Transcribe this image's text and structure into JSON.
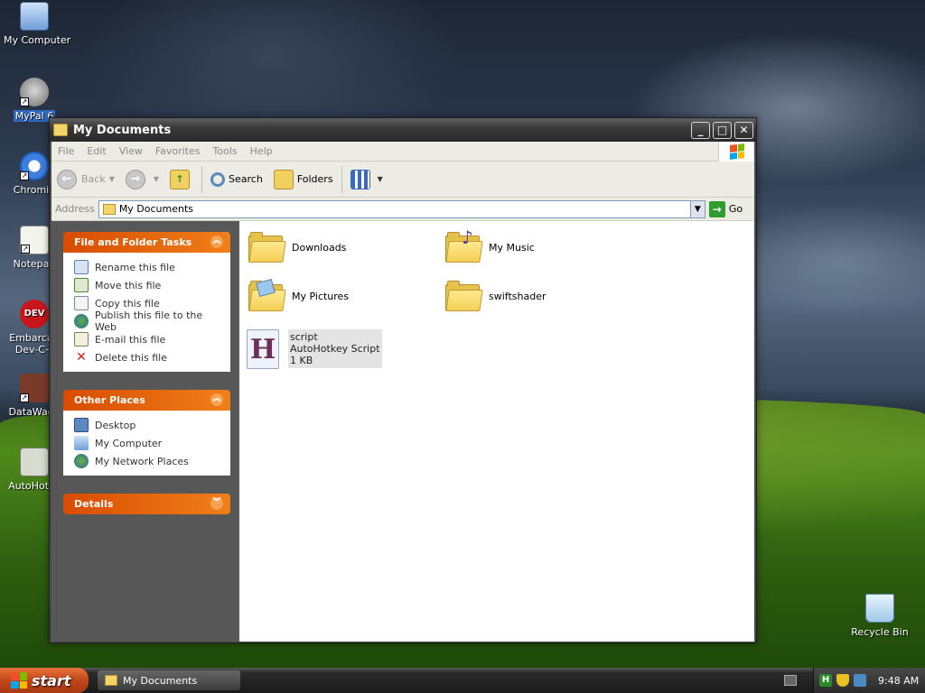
{
  "desktop": {
    "icons": [
      {
        "label": "My Computer"
      },
      {
        "label": "MyPal 6"
      },
      {
        "label": "Chromiu"
      },
      {
        "label": "Notepad"
      },
      {
        "label": "Embarcad Dev-C+"
      },
      {
        "label": "DataWago"
      },
      {
        "label": "AutoHotke"
      },
      {
        "label": "Recycle Bin"
      }
    ]
  },
  "window": {
    "title": "My Documents",
    "menu": [
      "File",
      "Edit",
      "View",
      "Favorites",
      "Tools",
      "Help"
    ],
    "toolbar": {
      "back": "Back",
      "search": "Search",
      "folders": "Folders"
    },
    "address": {
      "label": "Address",
      "value": "My Documents",
      "go": "Go"
    },
    "tasks_panel": {
      "title": "File and Folder Tasks",
      "items": [
        "Rename this file",
        "Move this file",
        "Copy this file",
        "Publish this file to the Web",
        "E-mail this file",
        "Delete this file"
      ]
    },
    "places_panel": {
      "title": "Other Places",
      "items": [
        "Desktop",
        "My Computer",
        "My Network Places"
      ]
    },
    "details_panel": {
      "title": "Details"
    },
    "files": [
      {
        "name": "Downloads"
      },
      {
        "name": "My Music"
      },
      {
        "name": "My Pictures"
      },
      {
        "name": "swiftshader"
      }
    ],
    "script_file": {
      "name": "script",
      "type": "AutoHotkey Script",
      "size": "1 KB"
    }
  },
  "taskbar": {
    "start": "start",
    "task_button": "My Documents",
    "clock": "9:48 AM"
  },
  "colors": {
    "panel_header": "#e0601a",
    "selection": "#316ac5",
    "start_button": "#c2461a"
  }
}
